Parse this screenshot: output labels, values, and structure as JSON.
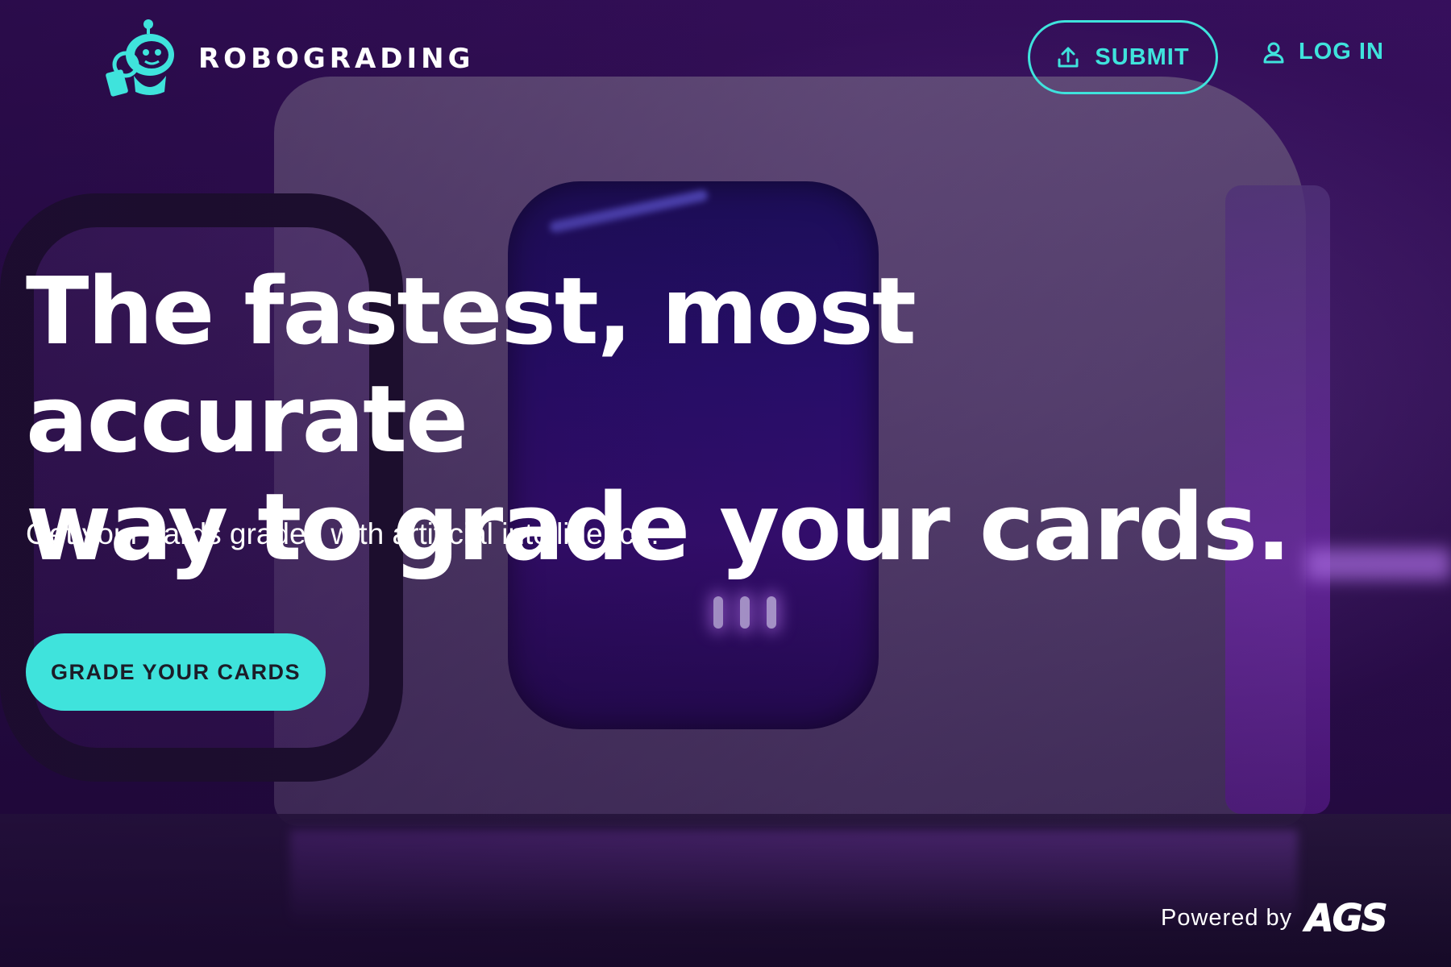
{
  "brand": {
    "name": "ROBOGRADING",
    "logo_icon": "robot-mascot-icon",
    "accent_color": "#3fe3dc"
  },
  "nav": {
    "submit_label": "SUBMIT",
    "submit_icon": "upload-icon",
    "login_label": "LOG IN",
    "login_icon": "user-icon"
  },
  "hero": {
    "headline_line1": "The fastest, most accurate",
    "headline_line2": "way to grade your cards.",
    "subheadline": "Get your cards graded with artificial intelligence.",
    "cta_label": "GRADE YOUR CARDS",
    "background": "card-grading-machine-photo"
  },
  "footer": {
    "powered_by_label": "Powered by",
    "partner_logo": "AGS"
  }
}
